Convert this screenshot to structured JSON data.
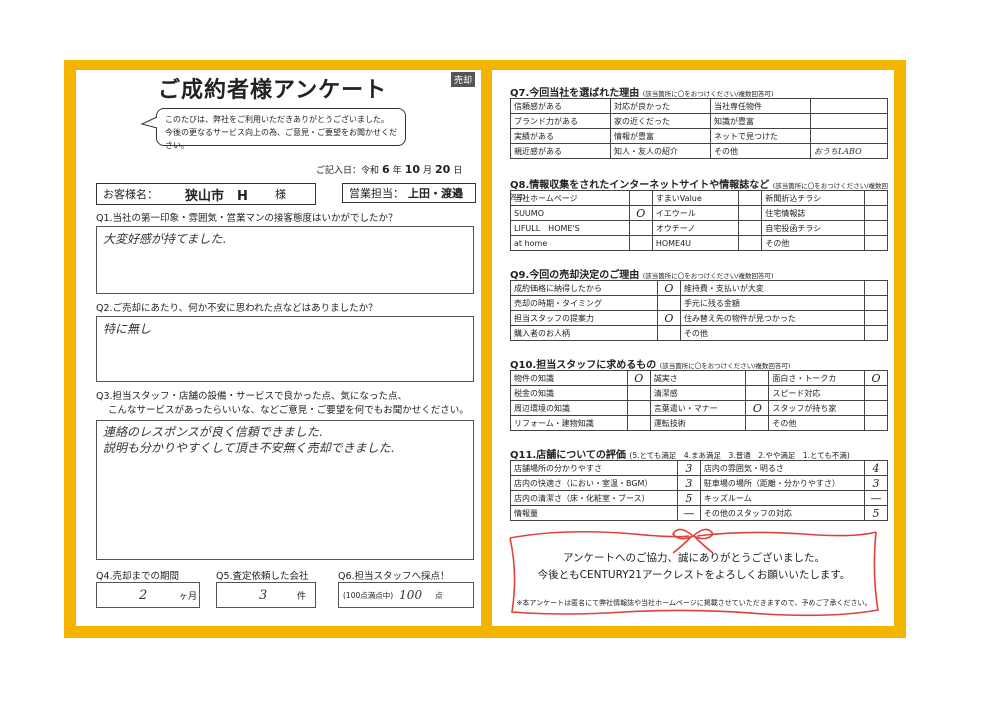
{
  "left": {
    "title": "ご成約者様アンケート",
    "tag": "売却",
    "intro": [
      "このたびは、弊社をご利用いただきありがとうございました。",
      "今後の更なるサービス向上の為、ご意見・ご要望をお聞かせください。"
    ],
    "date": {
      "label": "ご記入日：令和",
      "year": "6",
      "year_unit": "年",
      "month": "10",
      "month_unit": "月",
      "day": "20",
      "day_unit": "日"
    },
    "customer": {
      "label": "お客様名：",
      "value": "狭山市　H",
      "suffix": "様"
    },
    "staff": {
      "label": "営業担当：",
      "value": "上田・渡邉"
    },
    "q1": {
      "question": "Q1.当社の第一印象・雰囲気・営業マンの接客態度はいかがでしたか？",
      "answer": "大変好感が持てました."
    },
    "q2": {
      "question": "Q2.ご売却にあたり、何か不安に思われた点などはありましたか？",
      "answer": "特に無し"
    },
    "q3": {
      "question": [
        "Q3.担当スタッフ・店舗の設備・サービスで良かった点、気になった点、",
        "こんなサービスがあったらいいな、などご意見・ご要望を何でもお聞かせください。"
      ],
      "answer": [
        "連絡のレスポンスが良く信頼できました.",
        "説明も分かりやすくして頂き不安無く売却できました."
      ]
    },
    "q4": {
      "question": "Q4.売却までの期間",
      "answer": "2",
      "unit": "ヶ月"
    },
    "q5": {
      "question": "Q5.査定依頼した会社",
      "answer": "3",
      "unit": "件"
    },
    "q6": {
      "question": "Q6.担当スタッフへ採点！",
      "prefix": "(100点満点中)",
      "answer": "100",
      "unit": "点"
    }
  },
  "right": {
    "q7": {
      "title": "Q7.今回当社を選ばれた理由",
      "note": "(該当箇所に〇をおつけください/複数回答可)",
      "rows": [
        [
          "信頼感がある",
          "対応が良かった",
          "当社専任物件"
        ],
        [
          "ブランド力がある",
          "家の近くだった",
          "知識が豊富"
        ],
        [
          "実績がある",
          "情報が豊富",
          "ネットで見つけた"
        ],
        [
          "親近感がある",
          "知人・友人の紹介",
          "その他"
        ]
      ],
      "other": "おうちLABO"
    },
    "q8": {
      "title": "Q8.情報収集をされたインターネットサイトや情報誌など",
      "note": "(該当箇所に〇をおつけください/複数回答可)",
      "rows": [
        [
          "当社ホームページ",
          "",
          "すまいValue",
          "",
          "新聞折込チラシ",
          ""
        ],
        [
          "SUUMO",
          "O",
          "イエウール",
          "",
          "住宅情報誌",
          ""
        ],
        [
          "LIFULL　HOME'S",
          "",
          "オウチーノ",
          "",
          "自宅投函チラシ",
          ""
        ],
        [
          "at home",
          "",
          "HOME4U",
          "",
          "その他",
          ""
        ]
      ]
    },
    "q9": {
      "title": "Q9.今回の売却決定のご理由",
      "note": "(該当箇所に〇をおつけください/複数回答可)",
      "rows": [
        [
          "成約価格に納得したから",
          "O",
          "維持費・支払いが大変",
          ""
        ],
        [
          "売却の時期・タイミング",
          "",
          "手元に残る金額",
          ""
        ],
        [
          "担当スタッフの提案力",
          "O",
          "住み替え先の物件が見つかった",
          ""
        ],
        [
          "購入者のお人柄",
          "",
          "その他",
          ""
        ]
      ]
    },
    "q10": {
      "title": "Q10.担当スタッフに求めるもの",
      "note": "(該当箇所に〇をおつけください/複数回答可)",
      "rows": [
        [
          "物件の知識",
          "O",
          "誠実さ",
          "",
          "面白さ・トークカ",
          "O"
        ],
        [
          "税金の知識",
          "",
          "清潔感",
          "",
          "スピード対応",
          ""
        ],
        [
          "周辺環境の知識",
          "",
          "言葉遣い・マナー",
          "O",
          "スタッフが持ち家",
          ""
        ],
        [
          "リフォーム・建物知識",
          "",
          "運転技術",
          "",
          "その他",
          ""
        ]
      ]
    },
    "q11": {
      "title": "Q11.店舗についての評価",
      "scale": "(5.とても満足　4.まあ満足　3.普通　2.やや満足　1.とても不満)",
      "rows": [
        [
          "店舗場所の分かりやすさ",
          "3",
          "店内の雰囲気・明るさ",
          "4"
        ],
        [
          "店内の快適さ（におい・室温・BGM）",
          "3",
          "駐車場の場所（距離・分かりやすさ）",
          "3"
        ],
        [
          "店内の清潔さ（床・化粧室・ブース）",
          "5",
          "キッズルーム",
          "—"
        ],
        [
          "情報量",
          "—",
          "その他のスタッフの対応",
          "5"
        ]
      ]
    },
    "thanks": [
      "アンケートへのご協力、誠にありがとうございました。",
      "今後ともCENTURY21アークレストをよろしくお願いいたします。"
    ],
    "note": "※本アンケートは匿名にて弊社情報誌や当社ホームページに掲載させていただきますので、予めご了承ください。"
  },
  "colors": {
    "frame": "#f5b400",
    "ribbon": "#e0413a"
  }
}
